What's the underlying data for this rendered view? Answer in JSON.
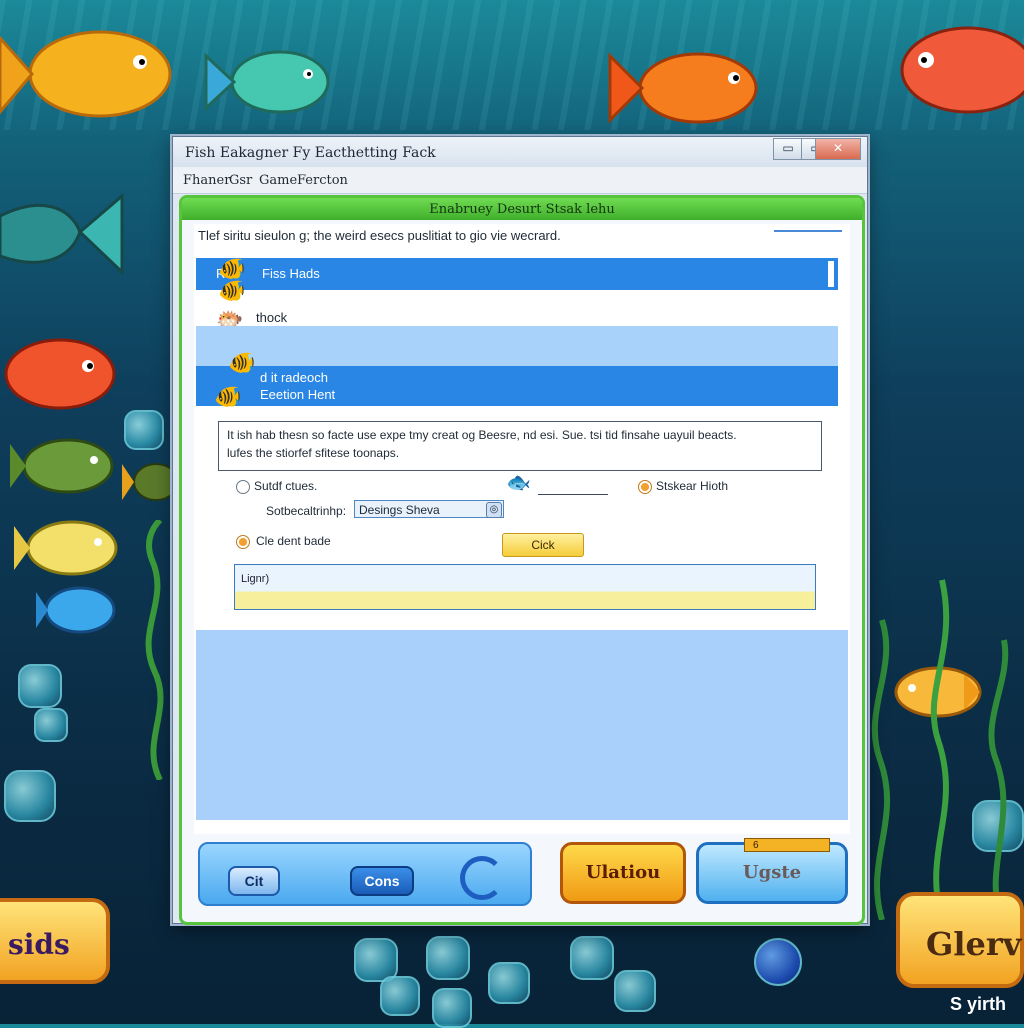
{
  "window": {
    "title": "Fish Eakagner Fy Eacthetting Fack",
    "controls": {
      "minimize": "▭",
      "maximize": "▭",
      "close": "✕"
    }
  },
  "menu": [
    "Fhaner",
    "Gsr",
    "Game",
    "Fercton"
  ],
  "panel": {
    "title": "Enabruey Desurt Stsak lehu",
    "description": "Tlef siritu sieulon g; the weird esecs puslitiat to gio vie wecrard.",
    "rows": [
      {
        "text": "Fiss Hads",
        "prefix": "Rc"
      },
      {
        "text": "thock"
      },
      {
        "text": ""
      },
      {
        "text": "d it radeoch",
        "subtext": "Eeetion Hent"
      }
    ],
    "info": {
      "line1": "It ish hab thesn so facte use expe tmy creat og Beesre, nd esi. Sue. tsi tid finsahe uayuil beacts.",
      "line2": "lufes the stiorfef sfitese toonaps."
    },
    "options": {
      "radio1_label": "Sutdf ctues.",
      "radio2_label": "Stskear Hioth",
      "radio3_label": "Cle dent bade",
      "field_label": "Sotbecaltrinhp:",
      "field_value": "Desings Sheva",
      "field_button": "◎",
      "click_label": "Cick"
    },
    "input_label": "Lignr)"
  },
  "footer": {
    "cut_label": "Cit",
    "cons_label": "Cons",
    "ulation_label": "Ulatiou",
    "update_label": "Ugste",
    "badge": "6"
  },
  "game": {
    "left_button": "sids",
    "right_button": "Glerv",
    "corner": "S yirth"
  },
  "icons": [
    "fish-icon",
    "swirl-icon",
    "close-icon"
  ],
  "colors": {
    "selected_row": "#2a86e4",
    "light_row": "#a9d2fb",
    "panel_border": "#58c43c"
  }
}
